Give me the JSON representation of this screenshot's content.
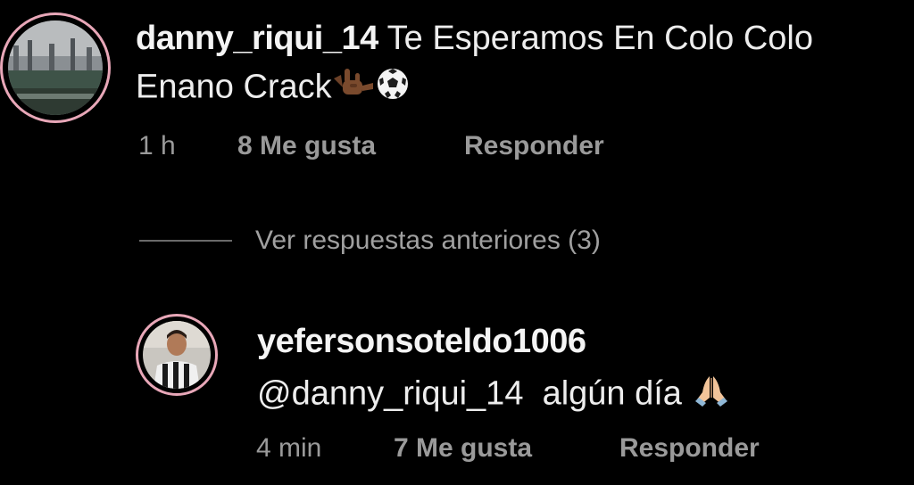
{
  "comments": [
    {
      "username": "danny_riqui_14",
      "text_line1": "Te Esperamos En Colo Colo",
      "text_line2": "Enano Crack",
      "emojis": [
        "sign-of-horns-icon",
        "soccer-ball-icon"
      ],
      "time": "1 h",
      "likes": "8 Me gusta",
      "reply_label": "Responder"
    },
    {
      "username": "yefersonsoteldo1006",
      "mention": "@danny_riqui_14",
      "text": "algún día",
      "emojis": [
        "folded-hands-icon"
      ],
      "time": "4 min",
      "likes": "7 Me gusta",
      "reply_label": "Responder"
    }
  ],
  "view_previous_replies": "Ver respuestas anteriores (3)",
  "colors": {
    "background": "#000000",
    "avatar_ring": "#e8a7b8",
    "primary_text": "#f2f2f2",
    "secondary_text": "#9a9a9a"
  }
}
